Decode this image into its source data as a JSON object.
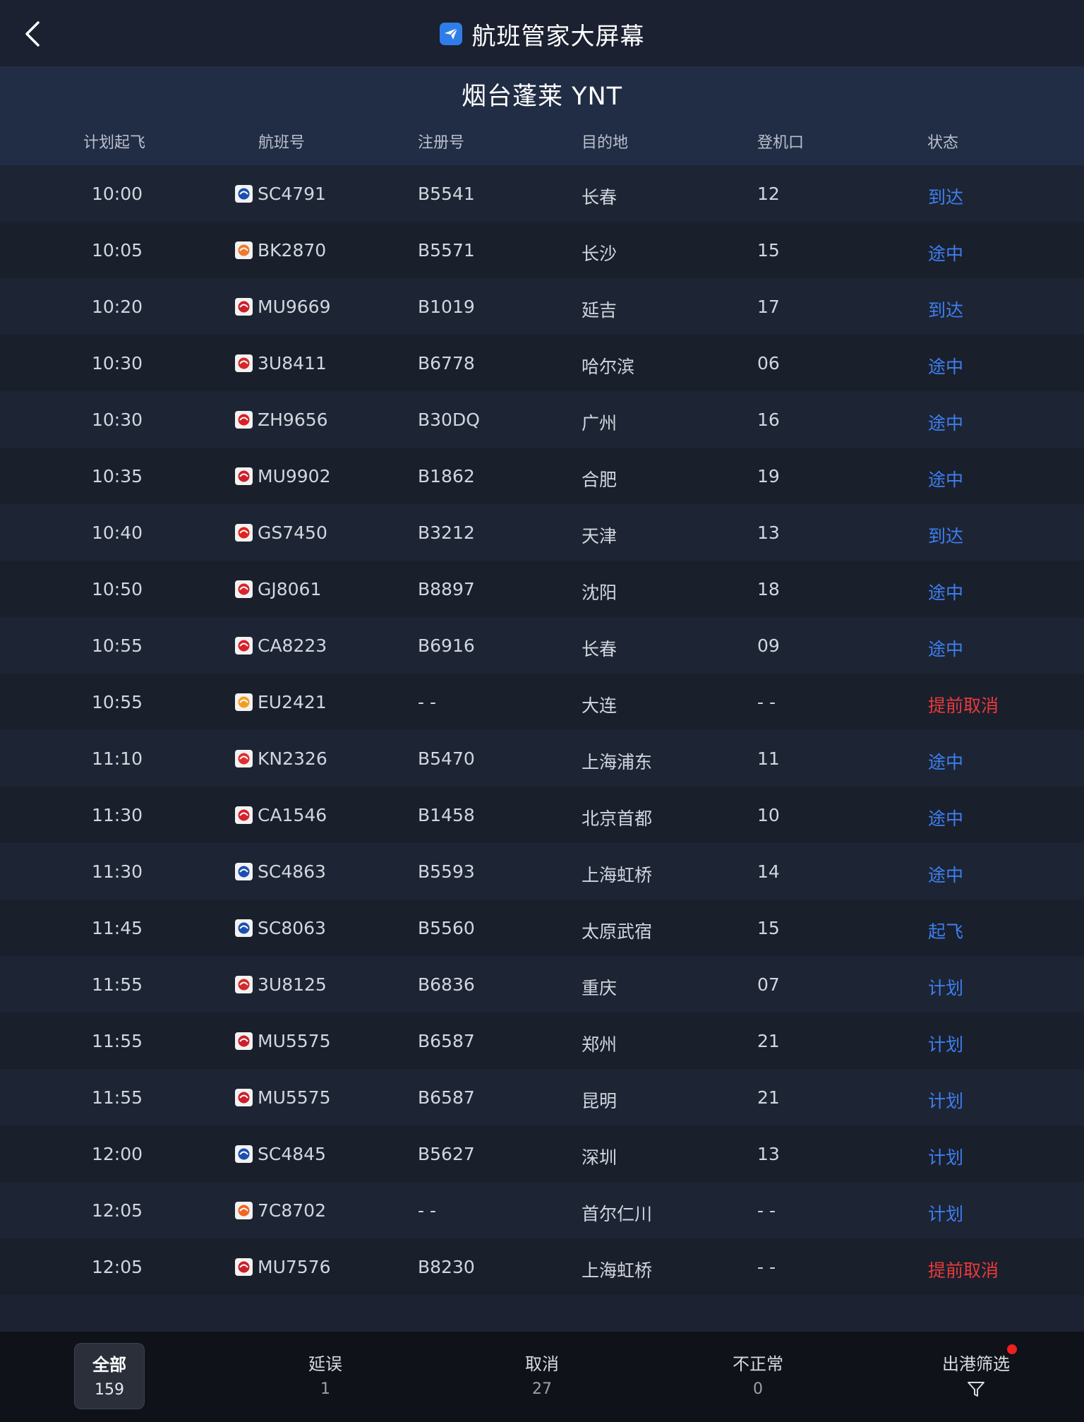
{
  "header": {
    "title": "航班管家大屏幕"
  },
  "airport": {
    "name": "烟台蓬莱  YNT"
  },
  "columns": {
    "time": "计划起飞",
    "flight": "航班号",
    "reg": "注册号",
    "dest": "目的地",
    "gate": "登机口",
    "status": "状态"
  },
  "flights": [
    {
      "time": "10:00",
      "flight": "SC4791",
      "reg": "B5541",
      "dest": "长春",
      "gate": "12",
      "status": "到达",
      "logo": "shandong-airlines-logo",
      "logo_color": "#1c4fb0",
      "status_color": "blue"
    },
    {
      "time": "10:05",
      "flight": "BK2870",
      "reg": "B5571",
      "dest": "长沙",
      "gate": "15",
      "status": "途中",
      "logo": "okay-airways-logo",
      "logo_color": "#f07a2a",
      "status_color": "blue"
    },
    {
      "time": "10:20",
      "flight": "MU9669",
      "reg": "B1019",
      "dest": "延吉",
      "gate": "17",
      "status": "到达",
      "logo": "china-eastern-logo",
      "logo_color": "#cc1f2a",
      "status_color": "blue"
    },
    {
      "time": "10:30",
      "flight": "3U8411",
      "reg": "B6778",
      "dest": "哈尔滨",
      "gate": "06",
      "status": "途中",
      "logo": "sichuan-airlines-logo",
      "logo_color": "#d42a2a",
      "status_color": "blue"
    },
    {
      "time": "10:30",
      "flight": "ZH9656",
      "reg": "B30DQ",
      "dest": "广州",
      "gate": "16",
      "status": "途中",
      "logo": "shenzhen-airlines-logo",
      "logo_color": "#d81f26",
      "status_color": "blue"
    },
    {
      "time": "10:35",
      "flight": "MU9902",
      "reg": "B1862",
      "dest": "合肥",
      "gate": "19",
      "status": "途中",
      "logo": "china-eastern-logo",
      "logo_color": "#cc1f2a",
      "status_color": "blue"
    },
    {
      "time": "10:40",
      "flight": "GS7450",
      "reg": "B3212",
      "dest": "天津",
      "gate": "13",
      "status": "到达",
      "logo": "tianjin-airlines-logo",
      "logo_color": "#e0231c",
      "status_color": "blue"
    },
    {
      "time": "10:50",
      "flight": "GJ8061",
      "reg": "B8897",
      "dest": "沈阳",
      "gate": "18",
      "status": "途中",
      "logo": "loong-air-logo",
      "logo_color": "#d6262e",
      "status_color": "blue"
    },
    {
      "time": "10:55",
      "flight": "CA8223",
      "reg": "B6916",
      "dest": "长春",
      "gate": "09",
      "status": "途中",
      "logo": "air-china-logo",
      "logo_color": "#d9202a",
      "status_color": "blue"
    },
    {
      "time": "10:55",
      "flight": "EU2421",
      "reg": "- -",
      "dest": "大连",
      "gate": "- -",
      "status": "提前取消",
      "logo": "chengdu-airlines-logo",
      "logo_color": "#f0a020",
      "status_color": "red"
    },
    {
      "time": "11:10",
      "flight": "KN2326",
      "reg": "B5470",
      "dest": "上海浦东",
      "gate": "11",
      "status": "途中",
      "logo": "china-united-logo",
      "logo_color": "#e03030",
      "status_color": "blue"
    },
    {
      "time": "11:30",
      "flight": "CA1546",
      "reg": "B1458",
      "dest": "北京首都",
      "gate": "10",
      "status": "途中",
      "logo": "air-china-logo",
      "logo_color": "#d9202a",
      "status_color": "blue"
    },
    {
      "time": "11:30",
      "flight": "SC4863",
      "reg": "B5593",
      "dest": "上海虹桥",
      "gate": "14",
      "status": "途中",
      "logo": "shandong-airlines-logo",
      "logo_color": "#1c4fb0",
      "status_color": "blue"
    },
    {
      "time": "11:45",
      "flight": "SC8063",
      "reg": "B5560",
      "dest": "太原武宿",
      "gate": "15",
      "status": "起飞",
      "logo": "shandong-airlines-logo",
      "logo_color": "#1c4fb0",
      "status_color": "blue"
    },
    {
      "time": "11:55",
      "flight": "3U8125",
      "reg": "B6836",
      "dest": "重庆",
      "gate": "07",
      "status": "计划",
      "logo": "sichuan-airlines-logo",
      "logo_color": "#d42a2a",
      "status_color": "blue"
    },
    {
      "time": "11:55",
      "flight": "MU5575",
      "reg": "B6587",
      "dest": "郑州",
      "gate": "21",
      "status": "计划",
      "logo": "china-eastern-logo",
      "logo_color": "#cc1f2a",
      "status_color": "blue"
    },
    {
      "time": "11:55",
      "flight": "MU5575",
      "reg": "B6587",
      "dest": "昆明",
      "gate": "21",
      "status": "计划",
      "logo": "china-eastern-logo",
      "logo_color": "#cc1f2a",
      "status_color": "blue"
    },
    {
      "time": "12:00",
      "flight": "SC4845",
      "reg": "B5627",
      "dest": "深圳",
      "gate": "13",
      "status": "计划",
      "logo": "shandong-airlines-logo",
      "logo_color": "#1c4fb0",
      "status_color": "blue"
    },
    {
      "time": "12:05",
      "flight": "7C8702",
      "reg": "- -",
      "dest": "首尔仁川",
      "gate": "- -",
      "status": "计划",
      "logo": "jeju-air-logo",
      "logo_color": "#f26522",
      "status_color": "blue"
    },
    {
      "time": "12:05",
      "flight": "MU7576",
      "reg": "B8230",
      "dest": "上海虹桥",
      "gate": "- -",
      "status": "提前取消",
      "logo": "china-eastern-logo",
      "logo_color": "#cc1f2a",
      "status_color": "red"
    }
  ],
  "bottom_tabs": [
    {
      "label": "全部",
      "count": "159"
    },
    {
      "label": "延误",
      "count": "1"
    },
    {
      "label": "取消",
      "count": "27"
    },
    {
      "label": "不正常",
      "count": "0"
    }
  ],
  "filter": {
    "label": "出港筛选",
    "icon": "filter-icon"
  },
  "colors": {
    "status_blue": "#3d7ff0",
    "status_red": "#e83a3a",
    "accent": "#2f7de8"
  }
}
